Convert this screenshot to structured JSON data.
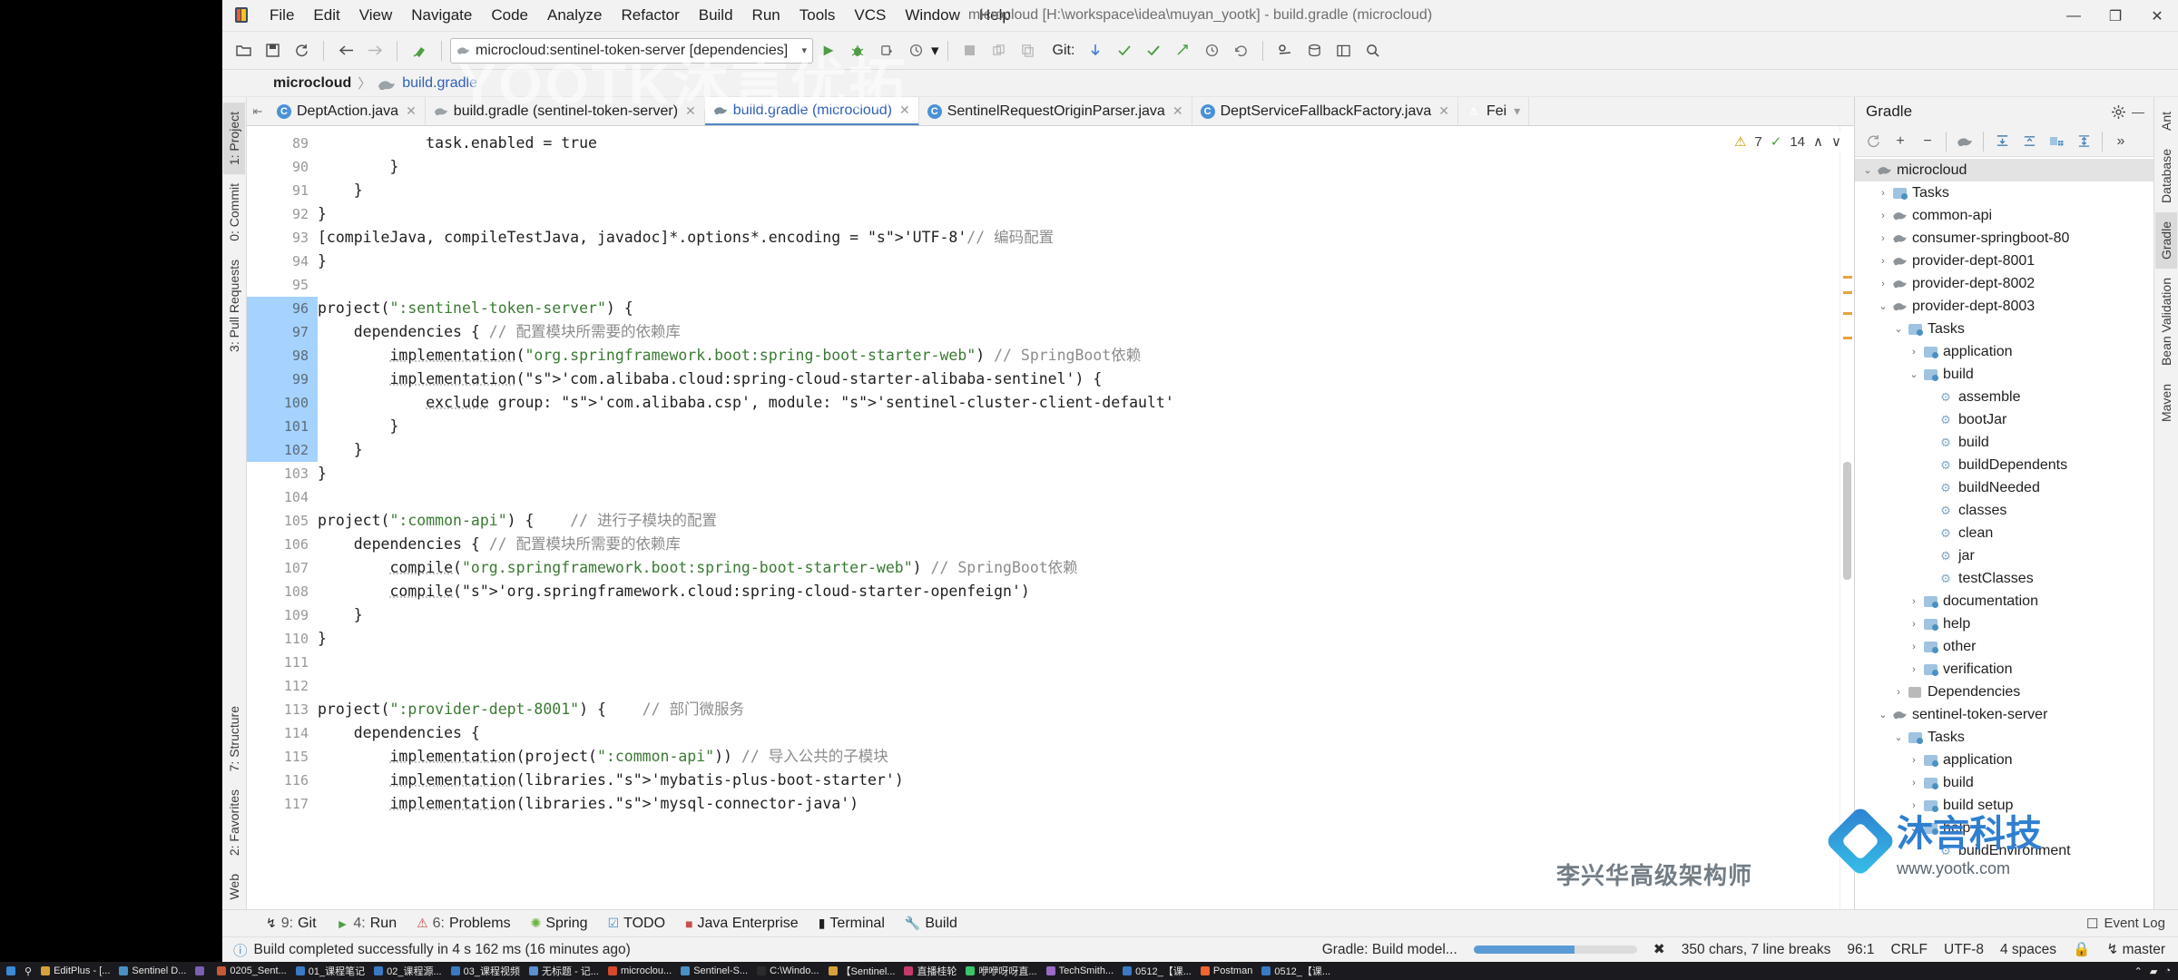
{
  "window": {
    "title": "microcloud [H:\\workspace\\idea\\muyan_yootk] - build.gradle (microcloud)",
    "minimize": "—",
    "maximize": "❐",
    "close": "✕"
  },
  "menu": [
    "File",
    "Edit",
    "View",
    "Navigate",
    "Code",
    "Analyze",
    "Refactor",
    "Build",
    "Run",
    "Tools",
    "VCS",
    "Window",
    "Help"
  ],
  "toolbar": {
    "open_title": "Open",
    "save_title": "Save All",
    "sync_title": "Sync",
    "back_title": "Back",
    "forward_title": "Forward",
    "build_title": "Build Project",
    "run_config": "microcloud:sentinel-token-server [dependencies]",
    "run_title": "Run",
    "debug_title": "Debug",
    "coverage_title": "Run with Coverage",
    "profile_title": "Profile",
    "stop_title": "Stop",
    "git_label": "Git:",
    "update_title": "Update Project",
    "commit_title": "Commit",
    "push_title": "Push",
    "history_title": "History",
    "rollback_title": "Rollback",
    "search_title": "Search Everywhere"
  },
  "breadcrumb": {
    "project": "microcloud",
    "separator": "〉",
    "file": "build.gradle"
  },
  "editor_tabs": [
    {
      "label": "DeptAction.java",
      "icon": "java-icon",
      "active": false
    },
    {
      "label": "build.gradle (sentinel-token-server)",
      "icon": "gradle-icon",
      "active": false
    },
    {
      "label": "build.gradle (microcloud)",
      "icon": "gradle-icon",
      "active": true
    },
    {
      "label": "SentinelRequestOriginParser.java",
      "icon": "java-icon",
      "active": false
    },
    {
      "label": "DeptServiceFallbackFactory.java",
      "icon": "java-icon",
      "active": false
    },
    {
      "label": "Fei",
      "icon": "warning-icon",
      "active": false
    }
  ],
  "inspection": {
    "warnings": "7",
    "checks": "14",
    "up": "∧",
    "down": "∨"
  },
  "code": {
    "first_line": 89,
    "selection_start_line": 96,
    "selection_end_line": 102,
    "caret_line_number": 103,
    "lines": [
      {
        "n": 89,
        "t": "            task.enabled = true",
        "fold": false
      },
      {
        "n": 90,
        "t": "        }",
        "fold": false
      },
      {
        "n": 91,
        "t": "    }",
        "fold": false
      },
      {
        "n": 92,
        "t": "}",
        "fold": false
      },
      {
        "n": 93,
        "t": "[compileJava, compileTestJava, javadoc]*.options*.encoding = 'UTF-8'// 编码配置",
        "fold": false
      },
      {
        "n": 94,
        "t": "}",
        "fold": false
      },
      {
        "n": 95,
        "t": "",
        "fold": false
      },
      {
        "n": 96,
        "t": "project(\":sentinel-token-server\") {",
        "fold": true
      },
      {
        "n": 97,
        "t": "    dependencies { // 配置模块所需要的依赖库",
        "fold": true
      },
      {
        "n": 98,
        "t": "        implementation(\"org.springframework.boot:spring-boot-starter-web\") // SpringBoot依赖",
        "fold": false
      },
      {
        "n": 99,
        "t": "        implementation('com.alibaba.cloud:spring-cloud-starter-alibaba-sentinel') {",
        "fold": true
      },
      {
        "n": 100,
        "t": "            exclude group: 'com.alibaba.csp', module: 'sentinel-cluster-client-default'",
        "fold": false
      },
      {
        "n": 101,
        "t": "        }",
        "fold": false
      },
      {
        "n": 102,
        "t": "    }",
        "fold": false
      },
      {
        "n": 103,
        "t": "}",
        "fold": false
      },
      {
        "n": 104,
        "t": "",
        "fold": false
      },
      {
        "n": 105,
        "t": "project(\":common-api\") {    // 进行子模块的配置",
        "fold": true
      },
      {
        "n": 106,
        "t": "    dependencies { // 配置模块所需要的依赖库",
        "fold": true
      },
      {
        "n": 107,
        "t": "        compile(\"org.springframework.boot:spring-boot-starter-web\") // SpringBoot依赖",
        "fold": false
      },
      {
        "n": 108,
        "t": "        compile('org.springframework.cloud:spring-cloud-starter-openfeign')",
        "fold": false
      },
      {
        "n": 109,
        "t": "    }",
        "fold": false
      },
      {
        "n": 110,
        "t": "}",
        "fold": false
      },
      {
        "n": 111,
        "t": "",
        "fold": false
      },
      {
        "n": 112,
        "t": "",
        "fold": false
      },
      {
        "n": 113,
        "t": "project(\":provider-dept-8001\") {    // 部门微服务",
        "fold": true
      },
      {
        "n": 114,
        "t": "    dependencies {",
        "fold": true
      },
      {
        "n": 115,
        "t": "        implementation(project(\":common-api\")) // 导入公共的子模块",
        "fold": false
      },
      {
        "n": 116,
        "t": "        implementation(libraries.'mybatis-plus-boot-starter')",
        "fold": false
      },
      {
        "n": 117,
        "t": "        implementation(libraries.'mysql-connector-java')",
        "fold": false
      }
    ]
  },
  "left_rail": [
    "1: Project",
    "0: Commit",
    "3: Pull Requests",
    "7: Structure",
    "2: Favorites",
    "Web"
  ],
  "right_rail": [
    "Ant",
    "Database",
    "Gradle",
    "Bean Validation",
    "Maven"
  ],
  "gradle": {
    "title": "Gradle",
    "settings_icon": "gear-icon",
    "hide_icon": "minimize-icon",
    "tools": [
      "refresh-icon",
      "add-icon",
      "remove-icon",
      "elephant-icon",
      "expand-all-icon",
      "collapse-all-icon",
      "execute-task-icon",
      "toggle-offline-icon",
      "more-icon"
    ],
    "tree": [
      {
        "label": "microcloud",
        "depth": 0,
        "arrow": "down",
        "icon": "gradle-module-icon",
        "selected": true
      },
      {
        "label": "Tasks",
        "depth": 1,
        "arrow": "right",
        "icon": "folder-icon"
      },
      {
        "label": "common-api",
        "depth": 1,
        "arrow": "right",
        "icon": "gradle-module-icon"
      },
      {
        "label": "consumer-springboot-80",
        "depth": 1,
        "arrow": "right",
        "icon": "gradle-module-icon"
      },
      {
        "label": "provider-dept-8001",
        "depth": 1,
        "arrow": "right",
        "icon": "gradle-module-icon"
      },
      {
        "label": "provider-dept-8002",
        "depth": 1,
        "arrow": "right",
        "icon": "gradle-module-icon"
      },
      {
        "label": "provider-dept-8003",
        "depth": 1,
        "arrow": "down",
        "icon": "gradle-module-icon"
      },
      {
        "label": "Tasks",
        "depth": 2,
        "arrow": "down",
        "icon": "folder-icon"
      },
      {
        "label": "application",
        "depth": 3,
        "arrow": "right",
        "icon": "folder-icon"
      },
      {
        "label": "build",
        "depth": 3,
        "arrow": "down",
        "icon": "folder-icon"
      },
      {
        "label": "assemble",
        "depth": 4,
        "arrow": "none",
        "icon": "gear-icon"
      },
      {
        "label": "bootJar",
        "depth": 4,
        "arrow": "none",
        "icon": "gear-icon"
      },
      {
        "label": "build",
        "depth": 4,
        "arrow": "none",
        "icon": "gear-icon"
      },
      {
        "label": "buildDependents",
        "depth": 4,
        "arrow": "none",
        "icon": "gear-icon"
      },
      {
        "label": "buildNeeded",
        "depth": 4,
        "arrow": "none",
        "icon": "gear-icon"
      },
      {
        "label": "classes",
        "depth": 4,
        "arrow": "none",
        "icon": "gear-icon"
      },
      {
        "label": "clean",
        "depth": 4,
        "arrow": "none",
        "icon": "gear-icon"
      },
      {
        "label": "jar",
        "depth": 4,
        "arrow": "none",
        "icon": "gear-icon"
      },
      {
        "label": "testClasses",
        "depth": 4,
        "arrow": "none",
        "icon": "gear-icon"
      },
      {
        "label": "documentation",
        "depth": 3,
        "arrow": "right",
        "icon": "folder-icon"
      },
      {
        "label": "help",
        "depth": 3,
        "arrow": "right",
        "icon": "folder-icon"
      },
      {
        "label": "other",
        "depth": 3,
        "arrow": "right",
        "icon": "folder-icon"
      },
      {
        "label": "verification",
        "depth": 3,
        "arrow": "right",
        "icon": "folder-icon"
      },
      {
        "label": "Dependencies",
        "depth": 2,
        "arrow": "right",
        "icon": "dependencies-icon"
      },
      {
        "label": "sentinel-token-server",
        "depth": 1,
        "arrow": "down",
        "icon": "gradle-module-icon"
      },
      {
        "label": "Tasks",
        "depth": 2,
        "arrow": "down",
        "icon": "folder-icon"
      },
      {
        "label": "application",
        "depth": 3,
        "arrow": "right",
        "icon": "folder-icon"
      },
      {
        "label": "build",
        "depth": 3,
        "arrow": "right",
        "icon": "folder-icon"
      },
      {
        "label": "build setup",
        "depth": 3,
        "arrow": "right",
        "icon": "folder-icon"
      },
      {
        "label": "help",
        "depth": 3,
        "arrow": "down",
        "icon": "folder-icon"
      },
      {
        "label": "buildEnvironment",
        "depth": 4,
        "arrow": "none",
        "icon": "gear-icon"
      }
    ]
  },
  "bottom_tabs": [
    {
      "num": "9:",
      "label": "Git",
      "icon": "branch-icon"
    },
    {
      "num": "4:",
      "label": "Run",
      "icon": "play-icon"
    },
    {
      "num": "6:",
      "label": "Problems",
      "icon": "problems-icon"
    },
    {
      "num": "",
      "label": "Spring",
      "icon": "spring-icon"
    },
    {
      "num": "",
      "label": "TODO",
      "icon": "todo-icon"
    },
    {
      "num": "",
      "label": "Java Enterprise",
      "icon": "java-ee-icon"
    },
    {
      "num": "",
      "label": "Terminal",
      "icon": "terminal-icon"
    },
    {
      "num": "",
      "label": "Build",
      "icon": "build-icon"
    }
  ],
  "event_log": {
    "label": "Event Log",
    "icon": "event-log-icon"
  },
  "status": {
    "message": "Build completed successfully in 4 s 162 ms (16 minutes ago)",
    "icon": "info-icon",
    "task": "Gradle: Build model...",
    "progress_percent": 62,
    "cancel_icon": "cancel-icon",
    "chars": "350 chars, 7 line breaks",
    "caret": "96:1",
    "line_sep": "CRLF",
    "encoding": "UTF-8",
    "indent": "4 spaces",
    "branch": "master",
    "branch_icon": "branch-icon",
    "lock_icon": "lock-icon"
  },
  "taskbar": {
    "items": [
      {
        "label": "EditPlus - [...",
        "color": "#d6a13a"
      },
      {
        "label": "Sentinel D...",
        "color": "#4a90c4"
      },
      {
        "label": "",
        "color": "#7a5fb5"
      },
      {
        "label": "0205_Sent...",
        "color": "#c45a3a"
      },
      {
        "label": "01_课程笔记",
        "color": "#3a7ac4"
      },
      {
        "label": "02_课程源...",
        "color": "#3a7ac4"
      },
      {
        "label": "03_课程视频",
        "color": "#3a7ac4"
      },
      {
        "label": "无标题 - 记...",
        "color": "#5a8fd0"
      },
      {
        "label": "microclou...",
        "color": "#d64a2a"
      },
      {
        "label": "Sentinel-S...",
        "color": "#4a90c4"
      },
      {
        "label": "C:\\Windo...",
        "color": "#2b2b2b"
      },
      {
        "label": "【Sentinel...",
        "color": "#d6a13a"
      },
      {
        "label": "直播桂轮",
        "color": "#c43a6a"
      },
      {
        "label": "咿咿呀呀直...",
        "color": "#3ac46a"
      },
      {
        "label": "TechSmith...",
        "color": "#9a6ac4"
      },
      {
        "label": "0512_【课...",
        "color": "#3a7ac4"
      },
      {
        "label": "Postman",
        "color": "#ef6430"
      },
      {
        "label": "0512_【课...",
        "color": "#3a7ac4"
      }
    ],
    "start_icon": "windows-icon",
    "search_icon": "search-icon",
    "taskview_icon": "task-view-icon"
  },
  "watermarks": {
    "main": "YOOTK沐言优拓",
    "logo_text": "沐言科技",
    "sub1": "www.yootk.com",
    "sub2": "李兴华高级架构师"
  }
}
